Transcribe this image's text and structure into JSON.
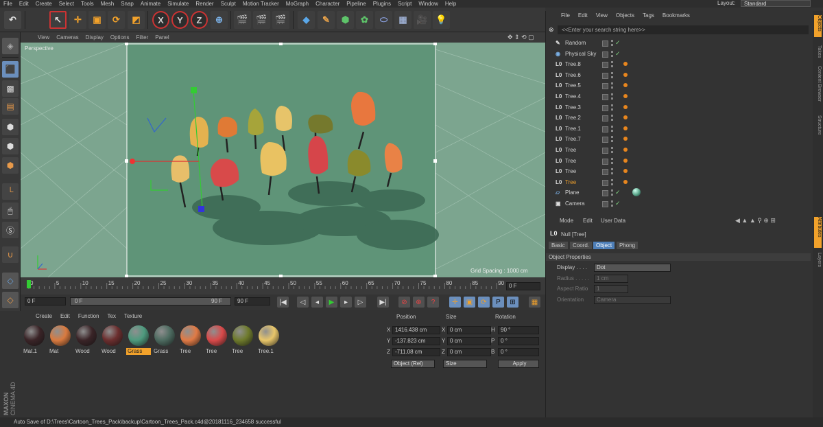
{
  "menubar": {
    "items": [
      "File",
      "Edit",
      "Create",
      "Select",
      "Tools",
      "Mesh",
      "Snap",
      "Animate",
      "Simulate",
      "Render",
      "Sculpt",
      "Motion Tracker",
      "MoGraph",
      "Character",
      "Pipeline",
      "Plugins",
      "Script",
      "Window",
      "Help"
    ],
    "layout_label": "Layout:",
    "layout_value": "Standard"
  },
  "toolbar": {
    "x_label": "X",
    "y_label": "Y",
    "z_label": "Z"
  },
  "viewport": {
    "menu": [
      "View",
      "Cameras",
      "Display",
      "Options",
      "Filter",
      "Panel"
    ],
    "camera_label": "Perspective",
    "grid_spacing": "Grid Spacing : 1000 cm"
  },
  "timeline": {
    "ticks": [
      "0",
      "5",
      "10",
      "15",
      "20",
      "25",
      "30",
      "35",
      "40",
      "45",
      "50",
      "55",
      "60",
      "65",
      "70",
      "75",
      "80",
      "85",
      "90"
    ],
    "current_frame": "0 F",
    "start_field": "0 F",
    "range_start": "0 F",
    "range_end": "90 F",
    "end_field": "90 F"
  },
  "materials": {
    "menu": [
      "Create",
      "Edit",
      "Function",
      "Tex",
      "Texture"
    ],
    "items": [
      {
        "name": "Mat.1",
        "color": "#3a2427"
      },
      {
        "name": "Mat",
        "color": "#d97a3f"
      },
      {
        "name": "Wood",
        "color": "#3a2427"
      },
      {
        "name": "Wood",
        "color": "#6b2e2e"
      },
      {
        "name": "Grass",
        "color": "#4e9a7e"
      },
      {
        "name": "Grass",
        "color": "#4d6b60"
      },
      {
        "name": "Tree",
        "color": "#e07a45"
      },
      {
        "name": "Tree",
        "color": "#d84a4a"
      },
      {
        "name": "Tree",
        "color": "#6e7a2c"
      },
      {
        "name": "Tree.1",
        "color": "#e8c66a"
      }
    ],
    "selected_index": 4
  },
  "coords": {
    "headers": [
      "Position",
      "Size",
      "Rotation"
    ],
    "rows": [
      {
        "axis": "X",
        "pos": "1416.438 cm",
        "saxis": "X",
        "size": "0 cm",
        "raxis": "H",
        "rot": "90 °"
      },
      {
        "axis": "Y",
        "pos": "-137.823 cm",
        "saxis": "Y",
        "size": "0 cm",
        "raxis": "P",
        "rot": "0 °"
      },
      {
        "axis": "Z",
        "pos": "-711.08 cm",
        "saxis": "Z",
        "size": "0 cm",
        "raxis": "B",
        "rot": "0 °"
      }
    ],
    "mode": "Object (Rel)",
    "size_mode": "Size",
    "apply": "Apply"
  },
  "object_manager": {
    "menu": [
      "File",
      "Edit",
      "View",
      "Objects",
      "Tags",
      "Bookmarks"
    ],
    "search_placeholder": "<<Enter your search string here>>",
    "objects": [
      {
        "name": "Random",
        "icon": "random-icon",
        "highlight": false,
        "tag": false
      },
      {
        "name": "Physical Sky",
        "icon": "sky-icon",
        "highlight": false,
        "tag": false
      },
      {
        "name": "Tree.8",
        "icon": "null-icon",
        "highlight": false,
        "tag": true
      },
      {
        "name": "Tree.6",
        "icon": "null-icon",
        "highlight": false,
        "tag": true
      },
      {
        "name": "Tree.5",
        "icon": "null-icon",
        "highlight": false,
        "tag": true
      },
      {
        "name": "Tree.4",
        "icon": "null-icon",
        "highlight": false,
        "tag": true
      },
      {
        "name": "Tree.3",
        "icon": "null-icon",
        "highlight": false,
        "tag": true
      },
      {
        "name": "Tree.2",
        "icon": "null-icon",
        "highlight": false,
        "tag": true
      },
      {
        "name": "Tree.1",
        "icon": "null-icon",
        "highlight": false,
        "tag": true
      },
      {
        "name": "Tree.7",
        "icon": "null-icon",
        "highlight": false,
        "tag": true
      },
      {
        "name": "Tree",
        "icon": "null-icon",
        "highlight": false,
        "tag": true
      },
      {
        "name": "Tree",
        "icon": "null-icon",
        "highlight": false,
        "tag": true
      },
      {
        "name": "Tree",
        "icon": "null-icon",
        "highlight": false,
        "tag": true
      },
      {
        "name": "Tree",
        "icon": "null-icon",
        "highlight": true,
        "tag": true
      },
      {
        "name": "Plane",
        "icon": "plane-icon",
        "highlight": false,
        "tag": false
      },
      {
        "name": "Camera",
        "icon": "camera-icon",
        "highlight": false,
        "tag": false
      }
    ]
  },
  "attributes": {
    "menu": [
      "Mode",
      "Edit",
      "User Data"
    ],
    "object_title": "Null [Tree]",
    "tabs": [
      "Basic",
      "Coord.",
      "Object",
      "Phong"
    ],
    "active_tab": "Object",
    "section": "Object Properties",
    "props": [
      {
        "label": "Display . . . .",
        "value": "Dot",
        "enabled": true
      },
      {
        "label": "Radius . . . . .",
        "value": "1 cm",
        "enabled": false
      },
      {
        "label": "Aspect Ratio",
        "value": "1",
        "enabled": false
      },
      {
        "label": "Orientation",
        "value": "Camera",
        "enabled": false
      }
    ]
  },
  "right_tabs": [
    "Objects",
    "Takes",
    "Content Browser",
    "Structure",
    "Attributes",
    "Layers"
  ],
  "brand": {
    "line1": "MAXON",
    "line2": "CINEMA 4D"
  },
  "status": "Auto Save of D:\\Trees\\Cartoon_Trees_Pack\\backup\\Cartoon_Trees_Pack.c4d@20181116_234658 successful",
  "colors": {
    "accent": "#f2a22b",
    "selected_blue": "#4e7fb8",
    "viewport_bg": "#7aa08b"
  }
}
